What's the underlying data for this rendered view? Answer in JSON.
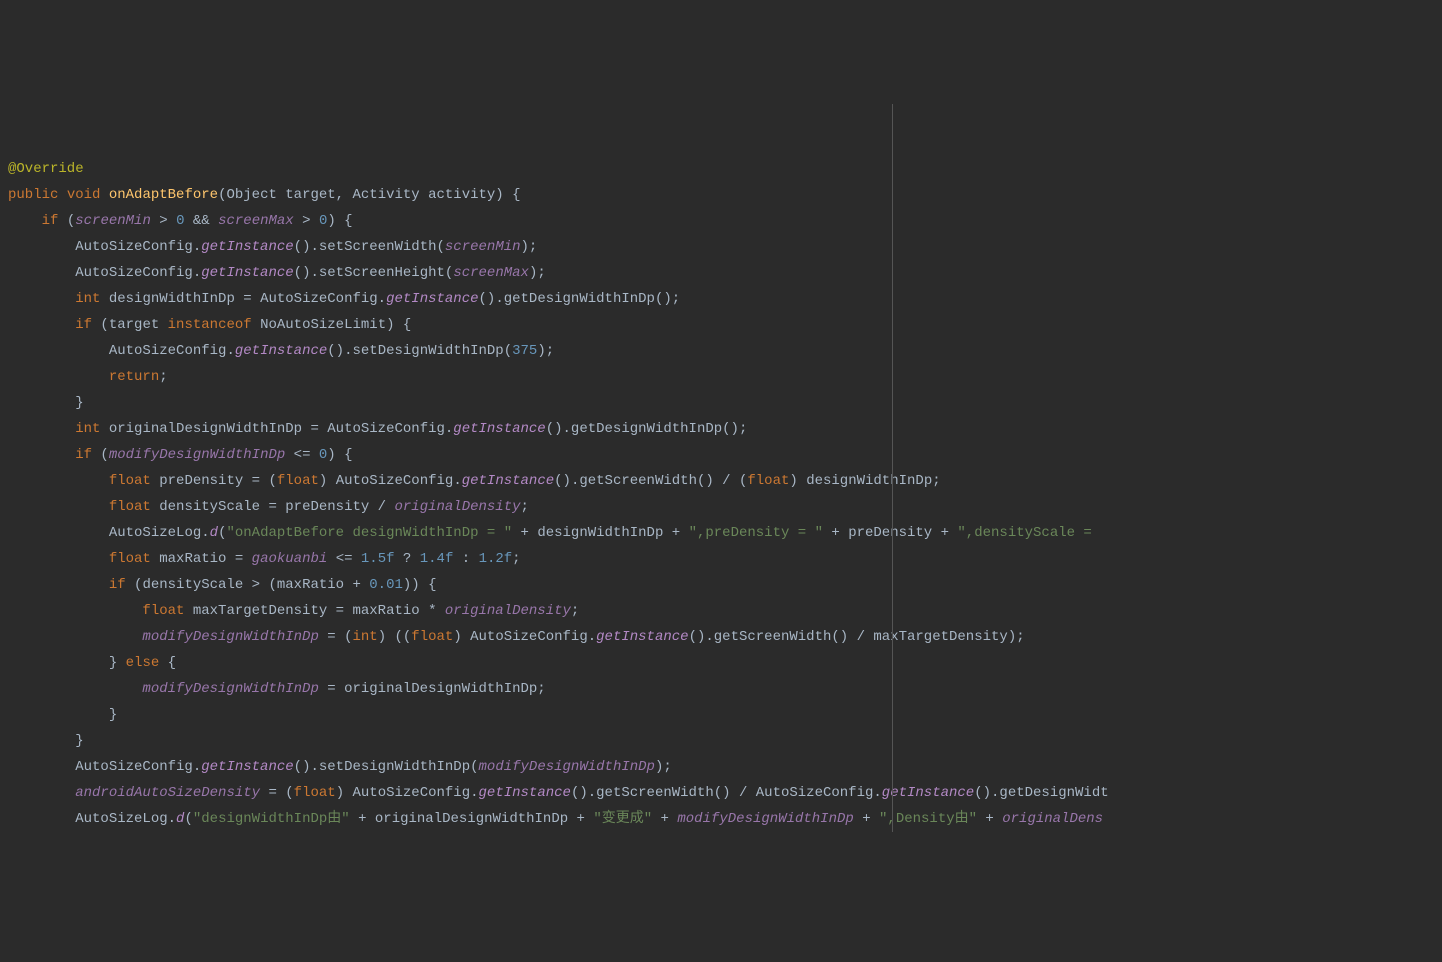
{
  "code": {
    "annotation": "@Override",
    "line1": {
      "kw_public": "public",
      "kw_void": "void",
      "method": "onAdaptBefore",
      "params": "(Object target, Activity activity) {"
    },
    "line2": {
      "kw_if": "if",
      "open": " (",
      "f1": "screenMin",
      "op1": " > ",
      "n1": "0",
      "op2": " && ",
      "f2": "screenMax",
      "op3": " > ",
      "n2": "0",
      "close": ") {"
    },
    "line3": {
      "t1": "AutoSizeConfig.",
      "m1": "getInstance",
      "t2": "().setScreenWidth(",
      "f1": "screenMin",
      "t3": ");"
    },
    "line4": {
      "t1": "AutoSizeConfig.",
      "m1": "getInstance",
      "t2": "().setScreenHeight(",
      "f1": "screenMax",
      "t3": ");"
    },
    "line5": {
      "kw": "int",
      "t1": " designWidthInDp = AutoSizeConfig.",
      "m1": "getInstance",
      "t2": "().getDesignWidthInDp();"
    },
    "line6": {
      "kw1": "if",
      "t1": " (target ",
      "kw2": "instanceof",
      "t2": " NoAutoSizeLimit) {"
    },
    "line7": {
      "t1": "AutoSizeConfig.",
      "m1": "getInstance",
      "t2": "().setDesignWidthInDp(",
      "n1": "375",
      "t3": ");"
    },
    "line8": {
      "kw": "return",
      "t": ";"
    },
    "line9": {
      "t": "}"
    },
    "line10": {
      "kw": "int",
      "t1": " originalDesignWidthInDp = AutoSizeConfig.",
      "m1": "getInstance",
      "t2": "().getDesignWidthInDp();"
    },
    "line11": {
      "kw": "if",
      "t1": " (",
      "f1": "modifyDesignWidthInDp",
      "t2": " <= ",
      "n1": "0",
      "t3": ") {"
    },
    "line12": {
      "kw1": "float",
      "t1": " preDensity = (",
      "kw2": "float",
      "t2": ") AutoSizeConfig.",
      "m1": "getInstance",
      "t3": "().getScreenWidth() / (",
      "kw3": "float",
      "t4": ") designWidthInDp;"
    },
    "line13": {
      "kw": "float",
      "t1": " densityScale = preDensity / ",
      "f1": "originalDensity",
      "t2": ";"
    },
    "line14": {
      "t1": "AutoSizeLog.",
      "m1": "d",
      "t2": "(",
      "s1": "\"onAdaptBefore designWidthInDp = \"",
      "t3": " + designWidthInDp + ",
      "s2": "\",preDensity = \"",
      "t4": " + preDensity + ",
      "s3": "\",densityScale = "
    },
    "line15": {
      "kw": "float",
      "t1": " maxRatio = ",
      "f1": "gaokuanbi",
      "t2": " <= ",
      "n1": "1.5f",
      "t3": " ? ",
      "n2": "1.4f",
      "t4": " : ",
      "n3": "1.2f",
      "t5": ";"
    },
    "line16": {
      "kw": "if",
      "t1": " (densityScale > (maxRatio + ",
      "n1": "0.01",
      "t2": ")) {"
    },
    "line17": {
      "kw": "float",
      "t1": " maxTargetDensity = maxRatio * ",
      "f1": "originalDensity",
      "t2": ";"
    },
    "line18": {
      "f1": "modifyDesignWidthInDp",
      "t1": " = (",
      "kw1": "int",
      "t2": ") ((",
      "kw2": "float",
      "t3": ") AutoSizeConfig.",
      "m1": "getInstance",
      "t4": "().getScreenWidth() / maxTargetDensity);"
    },
    "line19": {
      "t1": "} ",
      "kw": "else",
      "t2": " {"
    },
    "line20": {
      "f1": "modifyDesignWidthInDp",
      "t1": " = originalDesignWidthInDp;"
    },
    "line21": {
      "t": "}"
    },
    "line22": {
      "t": "}"
    },
    "line23": {
      "t1": "AutoSizeConfig.",
      "m1": "getInstance",
      "t2": "().setDesignWidthInDp(",
      "f1": "modifyDesignWidthInDp",
      "t3": ");"
    },
    "line24": {
      "f1": "androidAutoSizeDensity",
      "t1": " = (",
      "kw": "float",
      "t2": ") AutoSizeConfig.",
      "m1": "getInstance",
      "t3": "().getScreenWidth() / AutoSizeConfig.",
      "m2": "getInstance",
      "t4": "().getDesignWidt"
    },
    "line25": {
      "t1": "AutoSizeLog.",
      "m1": "d",
      "t2": "(",
      "s1": "\"designWidthInDp由\"",
      "t3": " + originalDesignWidthInDp + ",
      "s2": "\"变更成\"",
      "t4": " + ",
      "f1": "modifyDesignWidthInDp",
      "t5": " + ",
      "s3": "\",Density由\"",
      "t6": " + ",
      "f2": "originalDens"
    }
  }
}
